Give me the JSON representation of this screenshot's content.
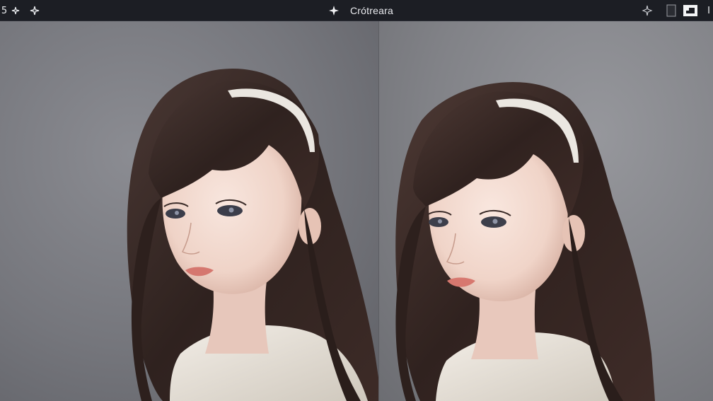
{
  "toolbar": {
    "left_items": [
      {
        "label": "5",
        "icon": "number-five-glyph"
      },
      {
        "label": "",
        "icon": "sparkle-small-icon"
      },
      {
        "label": "",
        "icon": "sparkle-icon"
      }
    ],
    "center_icon": "pin-icon",
    "title": "Crótreara",
    "right_items": [
      {
        "icon": "move-cursor-icon"
      },
      {
        "icon": "panel-toggle-icon"
      },
      {
        "icon": "crop-frame-icon"
      },
      {
        "label": "I",
        "icon": "info-glyph"
      }
    ]
  },
  "panels": [
    {
      "name": "left-portrait",
      "alt": "portrait"
    },
    {
      "name": "right-portrait",
      "alt": "portrait"
    }
  ],
  "colors": {
    "toolbar_bg": "#1c1e24",
    "canvas_bg": "#7a7b80",
    "hair": "#3a2a26",
    "skin": "#f1d9cf",
    "headband": "#e8e4de",
    "sweater": "#ece6dc"
  }
}
